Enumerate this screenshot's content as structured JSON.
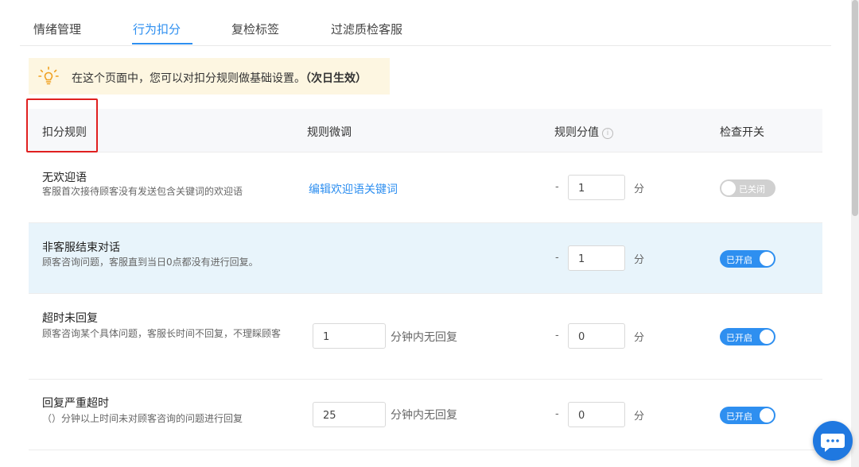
{
  "tabs": [
    {
      "label": "情绪管理",
      "active": false
    },
    {
      "label": "行为扣分",
      "active": true
    },
    {
      "label": "复检标签",
      "active": false
    },
    {
      "label": "过滤质检客服",
      "active": false
    }
  ],
  "notice": {
    "text": "在这个页面中，您可以对扣分规则做基础设置。",
    "emphasis": "（次日生效）",
    "icon": "lightbulb-icon"
  },
  "table": {
    "headers": {
      "rule": "扣分规则",
      "tune": "规则微调",
      "score": "规则分值",
      "switch": "检查开关"
    },
    "rows": [
      {
        "title": "无欢迎语",
        "desc": "客服首次接待顾客没有发送包含关键词的欢迎语",
        "link": "编辑欢迎语关键词",
        "minus": "-",
        "value": "1",
        "unit": "分",
        "toggle_label": "已关闭",
        "enabled": false
      },
      {
        "title": "非客服结束对话",
        "desc": "顾客咨询问题，客服直到当日0点都没有进行回复。",
        "minus": "-",
        "value": "1",
        "unit": "分",
        "toggle_label": "已开启",
        "enabled": true
      },
      {
        "title": "超时未回复",
        "desc": "顾客咨询某个具体问题，客服长时间不回复，不理睬顾客",
        "minutes": "1",
        "suffix": "分钟内无回复",
        "minus": "-",
        "value": "0",
        "unit": "分",
        "toggle_label": "已开启",
        "enabled": true
      },
      {
        "title": "回复严重超时",
        "desc": "（）分钟以上时间未对顾客咨询的问题进行回复",
        "minutes": "25",
        "suffix": "分钟内无回复",
        "minus": "-",
        "value": "0",
        "unit": "分",
        "toggle_label": "已开启",
        "enabled": true
      }
    ]
  },
  "colors": {
    "accent": "#2e8ff0",
    "highlight_border": "#e02020",
    "notice_bg": "#fdf6e1",
    "row_highlight": "#e8f4fb"
  }
}
